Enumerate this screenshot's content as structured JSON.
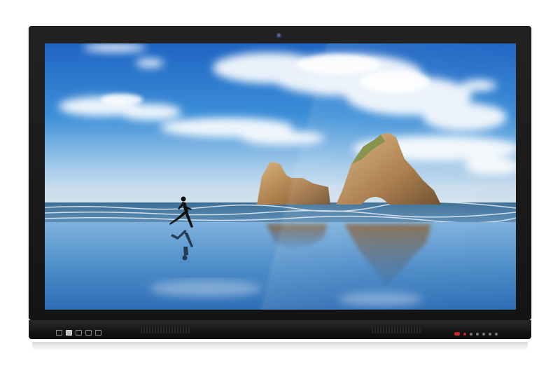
{
  "device": {
    "type": "interactive-flat-panel-display",
    "bezel_color": "#1a1a1a",
    "screen_image": "wallpaper-beach-rocks-runner",
    "icons": [
      "camera-icon",
      "power-button-icon",
      "usb-port-icon",
      "hdmi-port-icon"
    ]
  },
  "colors": {
    "sky_top": "#1f6fc9",
    "sky_horizon": "#9cc7e8",
    "sea": "#2f6fa8",
    "rock": "#b58a55",
    "power_led": "#d0262a"
  }
}
